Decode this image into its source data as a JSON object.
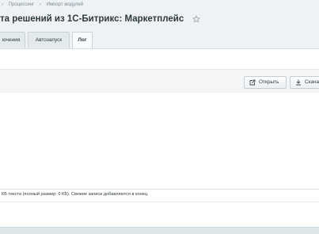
{
  "breadcrumb": {
    "items": [
      "Процессинг",
      "Импорт модулей"
    ]
  },
  "page": {
    "title": "та решений из 1С-Битрикс: Маркетплейс"
  },
  "tabs": [
    {
      "label": "ючения",
      "active": false
    },
    {
      "label": "Автозапуск",
      "active": false
    },
    {
      "label": "Лог",
      "active": true
    }
  ],
  "toolbar": {
    "open_label": "Открыть",
    "download_label": "Скача"
  },
  "log": {
    "footer_text": "КБ текста (полный размер: 0 КБ). Свежие записи добавляются в конец."
  },
  "colors": {
    "background": "#eef2f4",
    "panel": "#ffffff",
    "title": "#2e3a40"
  },
  "icons": [
    "chevron-right-icon",
    "star-icon",
    "open-external-icon",
    "download-icon"
  ]
}
